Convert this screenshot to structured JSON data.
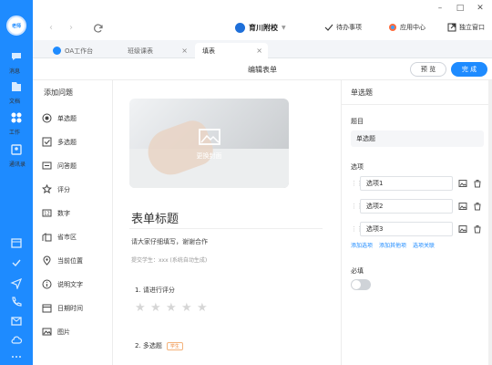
{
  "sidebar": {
    "avatar_text": "老师",
    "items": [
      {
        "label": "消息",
        "icon": "chat-icon"
      },
      {
        "label": "文档",
        "icon": "document-icon"
      },
      {
        "label": "工作",
        "icon": "grid-icon"
      },
      {
        "label": "通讯录",
        "icon": "contacts-icon"
      }
    ],
    "bottom_icons": [
      "calendar-icon",
      "check-icon",
      "send-icon",
      "phone-icon",
      "mail-icon",
      "cloud-icon",
      "more-icon"
    ]
  },
  "titlebar": {
    "org_name": "育川附校",
    "todo_label": "待办事项",
    "app_center_label": "应用中心",
    "standalone_label": "独立窗口"
  },
  "tabs": [
    {
      "label": "OA工作台"
    },
    {
      "label": "班级课表"
    },
    {
      "label": "填表"
    }
  ],
  "editor": {
    "title": "编辑表单",
    "preview_label": "预 览",
    "done_label": "完 成"
  },
  "question_panel": {
    "title": "添加问题",
    "items": [
      {
        "label": "单选题",
        "icon": "radio-icon"
      },
      {
        "label": "多选题",
        "icon": "checkbox-icon"
      },
      {
        "label": "问答题",
        "icon": "text-icon"
      },
      {
        "label": "评分",
        "icon": "star-icon"
      },
      {
        "label": "数字",
        "icon": "number-icon"
      },
      {
        "label": "省市区",
        "icon": "building-icon"
      },
      {
        "label": "当前位置",
        "icon": "location-icon"
      },
      {
        "label": "说明文字",
        "icon": "info-icon"
      },
      {
        "label": "日期时间",
        "icon": "calendar-icon"
      },
      {
        "label": "图片",
        "icon": "image-icon"
      }
    ]
  },
  "form": {
    "cover_caption": "更换封面",
    "title": "表单标题",
    "description": "请大家仔细填写，谢谢合作",
    "submitter": "提交学生：xxx (系统自动生成)",
    "q1": "1. 请进行评分",
    "q2": "2. 多选题",
    "q2_tag": "学生"
  },
  "props": {
    "header": "单选题",
    "title_label": "题目",
    "title_value": "单选题",
    "options_label": "选项",
    "options": [
      "选项1",
      "选项2",
      "选项3"
    ],
    "links": [
      "添加选项",
      "添加其他项",
      "选项关联"
    ],
    "required_label": "必填"
  },
  "colors": {
    "accent": "#1e8bff"
  }
}
